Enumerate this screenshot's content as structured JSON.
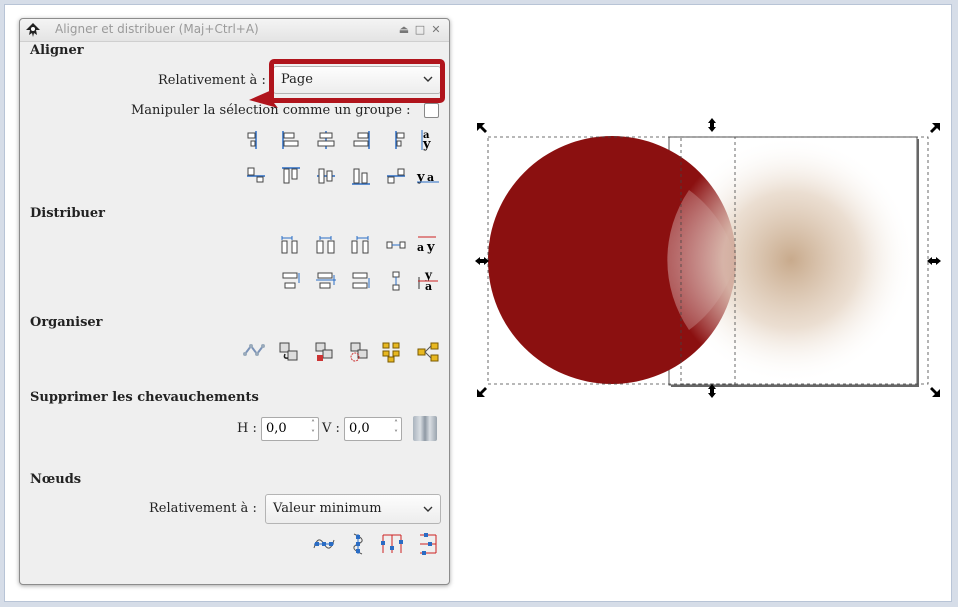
{
  "dialog": {
    "title": "Aligner et distribuer (Maj+Ctrl+A)",
    "align": {
      "heading": "Aligner",
      "relative_label": "Relativement à :",
      "relative_value": "Page",
      "group_label": "Manipuler la sélection comme un groupe :",
      "group_checked": false
    },
    "distribute": {
      "heading": "Distribuer"
    },
    "arrange": {
      "heading": "Organiser"
    },
    "overlap": {
      "heading": "Supprimer les chevauchements",
      "h_label": "H :",
      "h_value": "0,0",
      "v_label": "V :",
      "v_value": "0,0"
    },
    "nodes": {
      "heading": "Nœuds",
      "relative_label": "Relativement à :",
      "relative_value": "Valeur minimum"
    }
  },
  "icon_text": {
    "glyph_a": "a",
    "glyph_y": "y"
  },
  "colors": {
    "highlight": "#b0141c",
    "circle_fill": "#8b1010",
    "gradient_center": "#c8aa8c",
    "icon_blue": "#2a6cc4"
  }
}
